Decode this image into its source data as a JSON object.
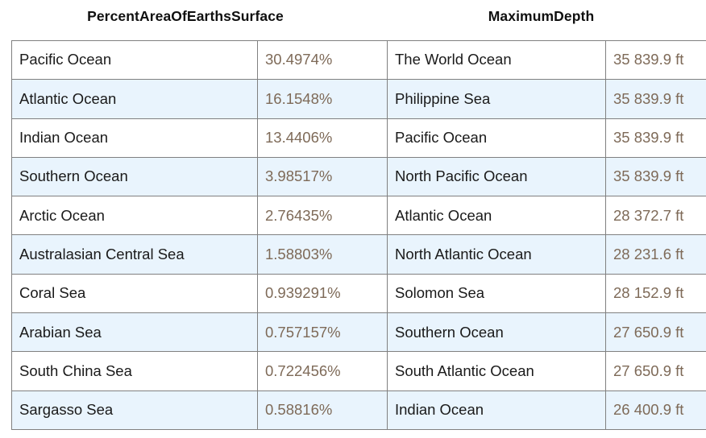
{
  "tables": [
    {
      "id": "percent-area-of-earths-surface",
      "title": "PercentAreaOfEarthsSurface",
      "rows": [
        {
          "label": "Pacific Ocean",
          "value": "30.4974%"
        },
        {
          "label": "Atlantic Ocean",
          "value": "16.1548%"
        },
        {
          "label": "Indian Ocean",
          "value": "13.4406%"
        },
        {
          "label": "Southern Ocean",
          "value": "3.98517%"
        },
        {
          "label": "Arctic Ocean",
          "value": "2.76435%"
        },
        {
          "label": "Australasian Central Sea",
          "value": "1.58803%"
        },
        {
          "label": "Coral Sea",
          "value": "0.939291%"
        },
        {
          "label": "Arabian Sea",
          "value": "0.757157%"
        },
        {
          "label": "South China Sea",
          "value": "0.722456%"
        },
        {
          "label": "Sargasso Sea",
          "value": "0.58816%"
        }
      ]
    },
    {
      "id": "maximum-depth",
      "title": "MaximumDepth",
      "rows": [
        {
          "label": "The World Ocean",
          "value": "35 839.9 ft"
        },
        {
          "label": "Philippine Sea",
          "value": "35 839.9 ft"
        },
        {
          "label": "Pacific Ocean",
          "value": "35 839.9 ft"
        },
        {
          "label": "North Pacific Ocean",
          "value": "35 839.9 ft"
        },
        {
          "label": "Atlantic Ocean",
          "value": "28 372.7 ft"
        },
        {
          "label": "North Atlantic Ocean",
          "value": "28 231.6 ft"
        },
        {
          "label": "Solomon Sea",
          "value": "28 152.9 ft"
        },
        {
          "label": "Southern Ocean",
          "value": "27 650.9 ft"
        },
        {
          "label": "South Atlantic Ocean",
          "value": "27 650.9 ft"
        },
        {
          "label": "Indian Ocean",
          "value": "26 400.9 ft"
        }
      ]
    }
  ],
  "colors": {
    "border": "#808080",
    "alt_row_background": "#e9f4fd",
    "row_background": "#ffffff",
    "label_text": "#1a1a1a",
    "value_text": "#7e6a58",
    "title_text": "#101010"
  }
}
